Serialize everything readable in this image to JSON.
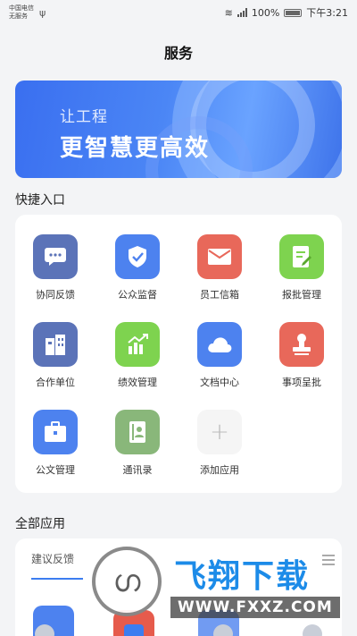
{
  "status_bar": {
    "carrier_line1": "中国电信",
    "carrier_line2": "无服务",
    "battery": "100%",
    "time": "下午3:21"
  },
  "header": {
    "title": "服务"
  },
  "banner": {
    "line1": "让工程",
    "line2": "更智慧更高效"
  },
  "quick_entry": {
    "title": "快捷入口",
    "items": [
      {
        "label": "协同反馈",
        "icon": "chat-icon",
        "color": "#5b73b8"
      },
      {
        "label": "公众监督",
        "icon": "shield-check-icon",
        "color": "#4d82ef"
      },
      {
        "label": "员工信箱",
        "icon": "mail-icon",
        "color": "#e8685a"
      },
      {
        "label": "报批管理",
        "icon": "document-edit-icon",
        "color": "#7ed34f"
      },
      {
        "label": "合作单位",
        "icon": "building-icon",
        "color": "#5b73b8"
      },
      {
        "label": "绩效管理",
        "icon": "chart-up-icon",
        "color": "#7ed34f"
      },
      {
        "label": "文档中心",
        "icon": "cloud-icon",
        "color": "#4d82ef"
      },
      {
        "label": "事项呈批",
        "icon": "stamp-icon",
        "color": "#e8685a"
      },
      {
        "label": "公文管理",
        "icon": "briefcase-icon",
        "color": "#4d82ef"
      },
      {
        "label": "通讯录",
        "icon": "contacts-book-icon",
        "color": "#89b77a"
      },
      {
        "label": "添加应用",
        "icon": "plus-icon",
        "color": "#f5f5f5"
      }
    ]
  },
  "all_apps": {
    "title": "全部应用",
    "tab": "建议反馈"
  },
  "watermark": {
    "text": "飞翔下载",
    "url": "WWW.FXXZ.COM"
  }
}
